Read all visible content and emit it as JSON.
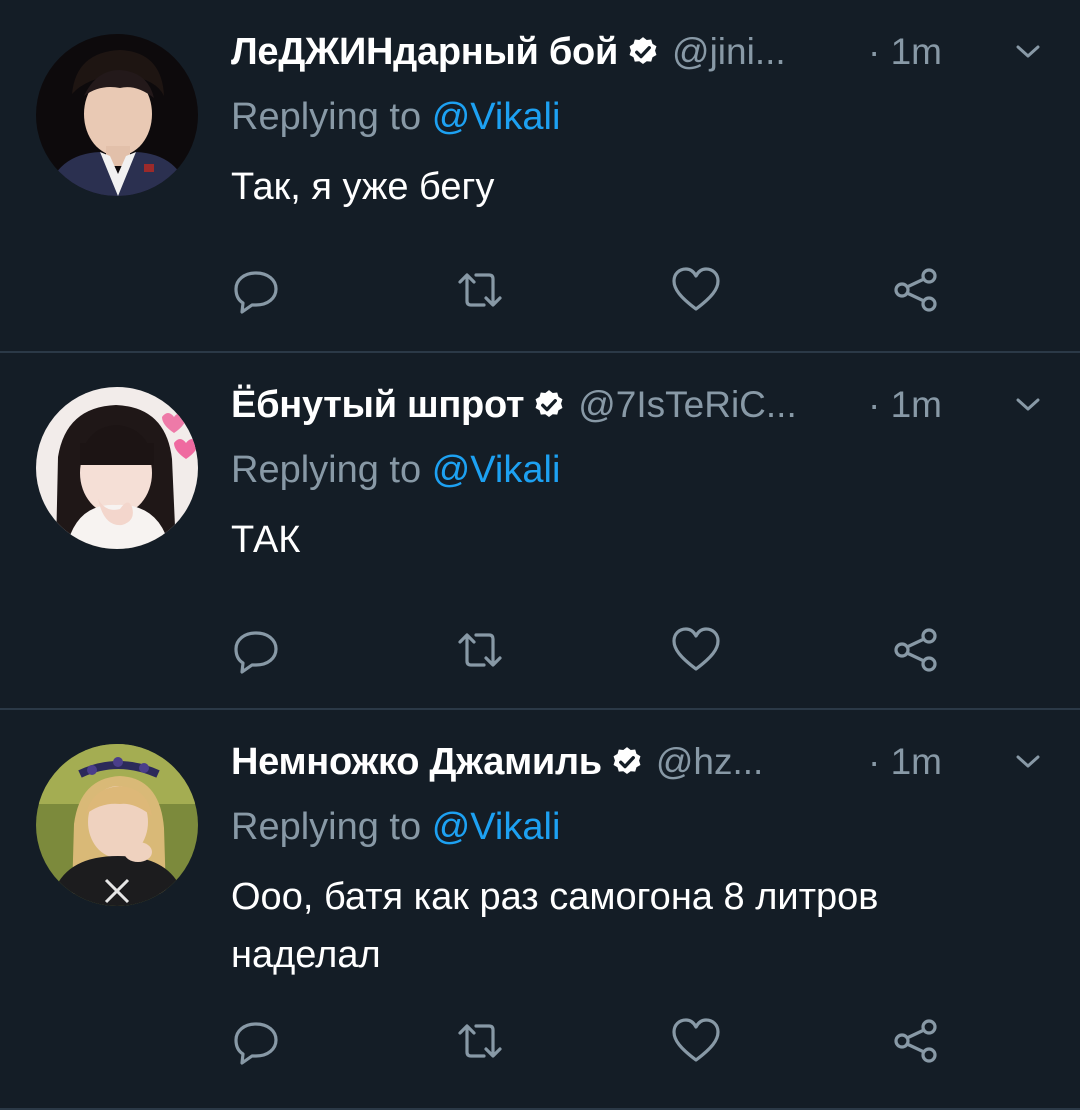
{
  "colors": {
    "background": "#141d26",
    "divider": "#2b3947",
    "secondary_text": "#8899a6",
    "link": "#1da1f2",
    "primary_text": "#ffffff"
  },
  "icons": {
    "verified": "verified-badge-icon",
    "menu": "chevron-down-icon",
    "reply": "reply-bubble-icon",
    "retweet": "retweet-icon",
    "like": "heart-icon",
    "share": "share-icon"
  },
  "tweets": [
    {
      "display_name": "ЛеДЖИНдарный бой",
      "handle": "@jini...",
      "time": "· 1m",
      "reply_prefix": "Replying to",
      "reply_to": "@Vikali",
      "text": "Так, я уже бегу",
      "verified": true
    },
    {
      "display_name": "Ёбнутый шпрот",
      "handle": "@7IsTeRiC...",
      "time": "· 1m",
      "reply_prefix": "Replying to",
      "reply_to": "@Vikali",
      "text": "ТАК",
      "verified": true
    },
    {
      "display_name": "Немножко Джамиль",
      "handle": "@hz...",
      "time": "· 1m",
      "reply_prefix": "Replying to",
      "reply_to": "@Vikali",
      "text": "Ооо, батя как раз самогона 8 литров наделал",
      "verified": true
    }
  ]
}
